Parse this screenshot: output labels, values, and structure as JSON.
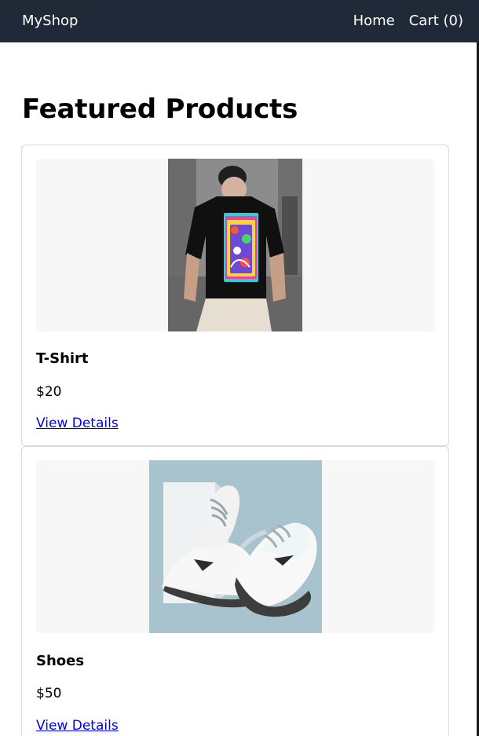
{
  "navbar": {
    "brand": "MyShop",
    "links": [
      "Home",
      "Cart (0)"
    ]
  },
  "main": {
    "title": "Featured Products",
    "products": [
      {
        "name": "T-Shirt",
        "price": "$20",
        "link_label": "View Details",
        "image": "t-shirt-photo"
      },
      {
        "name": "Shoes",
        "price": "$50",
        "link_label": "View Details",
        "image": "shoes-photo"
      }
    ]
  },
  "colors": {
    "navbar_bg": "#1f2937",
    "link": "#0000ee",
    "card_border": "#d9d9d9",
    "image_bg": "#f7f7f7"
  }
}
